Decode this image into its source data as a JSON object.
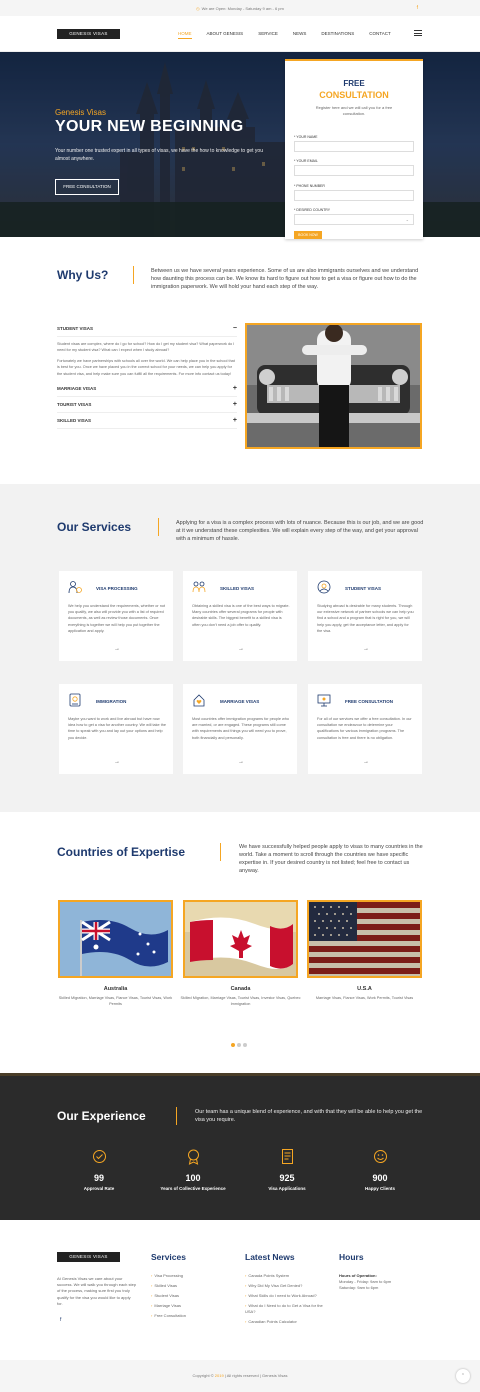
{
  "topbar": {
    "hours": "We are Open: Monday - Saturday 9 am - 6 pm",
    "fb": "f"
  },
  "brand": "GENESIS VISAS",
  "nav": [
    "HOME",
    "ABOUT GENESIS",
    "SERVICE",
    "NEWS",
    "DESTINATIONS",
    "CONTACT"
  ],
  "hero": {
    "pre": "Genesis Visas",
    "title": "YOUR NEW BEGINNING",
    "desc": "Your number one trusted expert in all types of visas, we have the how to knowledge to get you almost anywhere.",
    "cta": "FREE CONSULTATION"
  },
  "form": {
    "t1": "FREE",
    "t2": "CONSULTATION",
    "sub": "Register here and we will call you for a free consultation.",
    "name": "* YOUR NAME",
    "email": "* YOUR EMAIL",
    "phone": "* PHONE NUMBER",
    "country": "* DESIRED COUNTRY",
    "submit": "BOOK NOW"
  },
  "why": {
    "title": "Why Us?",
    "desc": "Between us we have several years experience. Some of us are also immigrants ourselves and we understand how daunting this process can be. We know its hard to figure out how to get a visa or figure out how to do the immigration paperwork. We will hold your hand each step of the way.",
    "acc": [
      {
        "label": "STUDENT VISAS",
        "sign": "−"
      },
      {
        "label": "MARRIAGE VISAS",
        "sign": "+"
      },
      {
        "label": "TOURIST VISAS",
        "sign": "+"
      },
      {
        "label": "SKILLED VISAS",
        "sign": "+"
      }
    ],
    "p1": "Student visas are complex, where do I go for school? How do I get my student visa? What paperwork do I need for my student visa? What can I expect when I study abroad?",
    "p2": "Fortunately we have partnerships with schools all over the world. We can help place you in the school that is best for you. Once we have placed you in the correct school for your needs, we can help you apply for the student visa, and help make sure you can fulfill all the requirements. For more info contact us today!"
  },
  "services": {
    "title": "Our Services",
    "desc": "Applying for a visa is a complex process with lots of nuance. Because this is our job, and we are good at it we understand these complexities. We will explain every step of the way, and get your approval with a minimum of hassle.",
    "cards": [
      {
        "title": "VISA PROCESSING",
        "text": "We help you understand the requirements, whether or not you qualify, we also will provide you with a list of required documents, as well as review those documents. Once everything is together we will help you put together the application and apply.",
        "icon": "visa-processing-icon"
      },
      {
        "title": "SKILLED VISAS",
        "text": "Obtaining a skilled visa is one of the best ways to migrate. Many countries offer several programs for people with desirable skills. The biggest benefit to a skilled visa is often you don't need a job offer to qualify.",
        "icon": "skilled-worker-icon"
      },
      {
        "title": "STUDENT VISAS",
        "text": "Studying abroad is desirable for many students. Through our extensive network of partner schools we can help you find a school and a program that is right for you, we will help you apply, get the acceptance letter, and apply for the visa.",
        "icon": "student-icon"
      },
      {
        "title": "IMMIGRATION",
        "text": "Maybe you want to work and live abroad but have now idea how to get a visa for another country. We will take the time to speak with you and lay out your options and help you decide.",
        "icon": "passport-icon"
      },
      {
        "title": "MARRIAGE VISAS",
        "text": "Most countries offer immigration programs for people who are married, or are engaged. These programs still come with requirements and things you will need you to prove, both financially and personally.",
        "icon": "marriage-icon"
      },
      {
        "title": "FREE CONSULTATION",
        "text": "For all of our services we offer a free consultation. In our consultation we endeavour to determine your qualifications for various immigration programs. The consultation is free and there is no obligation.",
        "icon": "consultation-icon"
      }
    ],
    "arrow": "→"
  },
  "countries": {
    "title": "Countries of Expertise",
    "desc": "We have successfully helped people apply to visas to many countries in the world. Take a moment to scroll through the countries we have specific expertise in. If your desired country is not listed; feel free to contact us anyway.",
    "items": [
      {
        "name": "Australia",
        "desc": "Skilled Migration, Marriage Visas, Fiance Visas, Tourist Visas, Work Permits"
      },
      {
        "name": "Canada",
        "desc": "Skilled Migration, Marriage Visas, Tourist Visas, Investor Visas, Quebec Immigration"
      },
      {
        "name": "U.S.A",
        "desc": "Marriage Visas, Fiance Visas, Work Permits, Tourist Visas"
      }
    ]
  },
  "experience": {
    "title": "Our Experience",
    "desc": "Our team has a unique blend of experience, and with that they will be able to help you get the visa you require.",
    "stats": [
      {
        "n": "99",
        "l": "Approval Rate"
      },
      {
        "n": "100",
        "l": "Years of Collective Experience"
      },
      {
        "n": "925",
        "l": "Visa Applications"
      },
      {
        "n": "900",
        "l": "Happy Clients"
      }
    ]
  },
  "footer": {
    "about": "At Genesis Visas we care about your success. We will walk you through each step of the process, making sure first you truly qualify for the visa you would like to apply for.",
    "services_title": "Services",
    "services": [
      "Visa Processing",
      "Skilled Visas",
      "Student Visas",
      "Marriage Visas",
      "Free Consultation"
    ],
    "news_title": "Latest News",
    "news": [
      "Canada Points System",
      "Why Did My Visa Get Denied?",
      "What Skills do I need to Work Abroad?",
      "What do I Need to do to Get a Visa for the USA?",
      "Canadian Points Calculator"
    ],
    "hours_title": "Hours",
    "hours_label": "Hours of Operation:",
    "hours": [
      "Monday - Friday: 9am to 6pm",
      "Saturday: 9am to 6pm"
    ],
    "fb": "f"
  },
  "bottom": {
    "pre": "Copyright ©",
    "year": "2019",
    "post": "| All rights reserved | Genesis Visas",
    "totop": "⌃"
  }
}
